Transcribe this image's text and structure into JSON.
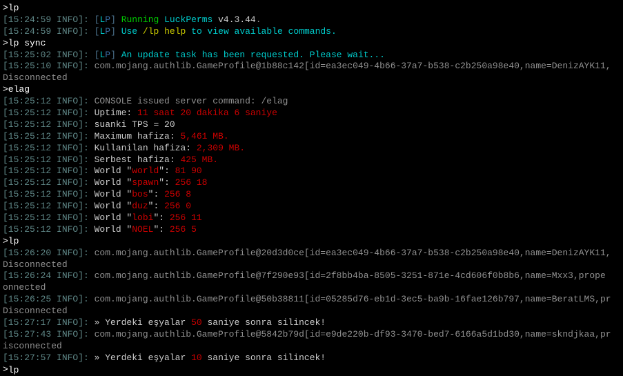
{
  "lines": [
    {
      "type": "input",
      "text": ">lp"
    },
    {
      "type": "lp",
      "ts": "[15:24:59 INFO]:",
      "segs": [
        {
          "cls": "green",
          "t": "Running"
        },
        {
          "cls": "cyan",
          "t": " LuckPerms"
        },
        {
          "cls": "white",
          "t": " v4.3.44"
        },
        {
          "cls": "gray",
          "t": "."
        }
      ]
    },
    {
      "type": "lp",
      "ts": "[15:24:59 INFO]:",
      "segs": [
        {
          "cls": "cyan",
          "t": "Use "
        },
        {
          "cls": "cmd",
          "t": "/lp help"
        },
        {
          "cls": "cyan",
          "t": " to view available commands."
        }
      ]
    },
    {
      "type": "input",
      "text": ">lp sync"
    },
    {
      "type": "lp",
      "ts": "[15:25:02 INFO]:",
      "segs": [
        {
          "cls": "cyan",
          "t": "An update task has been requested. Please wait..."
        }
      ]
    },
    {
      "type": "plain",
      "ts": "[15:25:10 INFO]:",
      "text": " com.mojang.authlib.GameProfile@1b88c142[id=ea3ec049-4b66-37a7-b538-c2b250a98e40,name=DenizAYK11,"
    },
    {
      "type": "cont",
      "text": " Disconnected"
    },
    {
      "type": "input",
      "text": ">elag"
    },
    {
      "type": "plain",
      "ts": "[15:25:12 INFO]:",
      "text": " CONSOLE issued server command: /elag"
    },
    {
      "type": "seg",
      "ts": "[15:25:12 INFO]:",
      "segs": [
        {
          "cls": "white",
          "t": " Uptime: "
        },
        {
          "cls": "red",
          "t": "11 saat 20 dakika 6 saniye"
        }
      ]
    },
    {
      "type": "seg",
      "ts": "[15:25:12 INFO]:",
      "segs": [
        {
          "cls": "white",
          "t": " suanki TPS = 20"
        }
      ]
    },
    {
      "type": "seg",
      "ts": "[15:25:12 INFO]:",
      "segs": [
        {
          "cls": "white",
          "t": " Maximum hafiza: "
        },
        {
          "cls": "red",
          "t": "5,461 MB."
        }
      ]
    },
    {
      "type": "seg",
      "ts": "[15:25:12 INFO]:",
      "segs": [
        {
          "cls": "white",
          "t": " Kullanilan hafiza: "
        },
        {
          "cls": "red",
          "t": "2,309 MB."
        }
      ]
    },
    {
      "type": "seg",
      "ts": "[15:25:12 INFO]:",
      "segs": [
        {
          "cls": "white",
          "t": " Serbest hafiza: "
        },
        {
          "cls": "red",
          "t": "425 MB."
        }
      ]
    },
    {
      "type": "seg",
      "ts": "[15:25:12 INFO]:",
      "segs": [
        {
          "cls": "white",
          "t": " World \""
        },
        {
          "cls": "red",
          "t": "world"
        },
        {
          "cls": "white",
          "t": "\": "
        },
        {
          "cls": "red",
          "t": "81 90"
        }
      ]
    },
    {
      "type": "seg",
      "ts": "[15:25:12 INFO]:",
      "segs": [
        {
          "cls": "white",
          "t": " World \""
        },
        {
          "cls": "red",
          "t": "spawn"
        },
        {
          "cls": "white",
          "t": "\": "
        },
        {
          "cls": "red",
          "t": "256 18"
        }
      ]
    },
    {
      "type": "seg",
      "ts": "[15:25:12 INFO]:",
      "segs": [
        {
          "cls": "white",
          "t": " World \""
        },
        {
          "cls": "red",
          "t": "bos"
        },
        {
          "cls": "white",
          "t": "\": "
        },
        {
          "cls": "red",
          "t": "256 8"
        }
      ]
    },
    {
      "type": "seg",
      "ts": "[15:25:12 INFO]:",
      "segs": [
        {
          "cls": "white",
          "t": " World \""
        },
        {
          "cls": "red",
          "t": "duz"
        },
        {
          "cls": "white",
          "t": "\": "
        },
        {
          "cls": "red",
          "t": "256 0"
        }
      ]
    },
    {
      "type": "seg",
      "ts": "[15:25:12 INFO]:",
      "segs": [
        {
          "cls": "white",
          "t": " World \""
        },
        {
          "cls": "red",
          "t": "lobi"
        },
        {
          "cls": "white",
          "t": "\": "
        },
        {
          "cls": "red",
          "t": "256 11"
        }
      ]
    },
    {
      "type": "seg",
      "ts": "[15:25:12 INFO]:",
      "segs": [
        {
          "cls": "white",
          "t": " World \""
        },
        {
          "cls": "red",
          "t": "NOEL"
        },
        {
          "cls": "white",
          "t": "\": "
        },
        {
          "cls": "red",
          "t": "256 5"
        }
      ]
    },
    {
      "type": "input",
      "text": ">lp"
    },
    {
      "type": "plain",
      "ts": "[15:26:20 INFO]:",
      "text": " com.mojang.authlib.GameProfile@20d3d0ce[id=ea3ec049-4b66-37a7-b538-c2b250a98e40,name=DenizAYK11,"
    },
    {
      "type": "cont",
      "text": " Disconnected"
    },
    {
      "type": "plain",
      "ts": "[15:26:24 INFO]:",
      "text": " com.mojang.authlib.GameProfile@7f290e93[id=2f8bb4ba-8505-3251-871e-4cd606f0b8b6,name=Mxx3,prope"
    },
    {
      "type": "cont",
      "text": "onnected"
    },
    {
      "type": "plain",
      "ts": "[15:26:25 INFO]:",
      "text": " com.mojang.authlib.GameProfile@50b38811[id=05285d76-eb1d-3ec5-ba9b-16fae126b797,name=BeratLMS,pr"
    },
    {
      "type": "cont",
      "text": "Disconnected"
    },
    {
      "type": "seg",
      "ts": "[15:27:17 INFO]:",
      "segs": [
        {
          "cls": "white",
          "t": " » Yerdeki eşyalar "
        },
        {
          "cls": "red",
          "t": "50"
        },
        {
          "cls": "white",
          "t": " saniye sonra silincek!"
        }
      ]
    },
    {
      "type": "plain",
      "ts": "[15:27:43 INFO]:",
      "text": " com.mojang.authlib.GameProfile@5842b79d[id=e9de220b-df93-3470-bed7-6166a5d1bd30,name=skndjkaa,pr"
    },
    {
      "type": "cont",
      "text": "isconnected"
    },
    {
      "type": "seg",
      "ts": "[15:27:57 INFO]:",
      "segs": [
        {
          "cls": "white",
          "t": " » Yerdeki eşyalar "
        },
        {
          "cls": "red",
          "t": "10"
        },
        {
          "cls": "white",
          "t": " saniye sonra silincek!"
        }
      ]
    }
  ],
  "prompt": {
    "symbol": ">",
    "value": "lp"
  }
}
